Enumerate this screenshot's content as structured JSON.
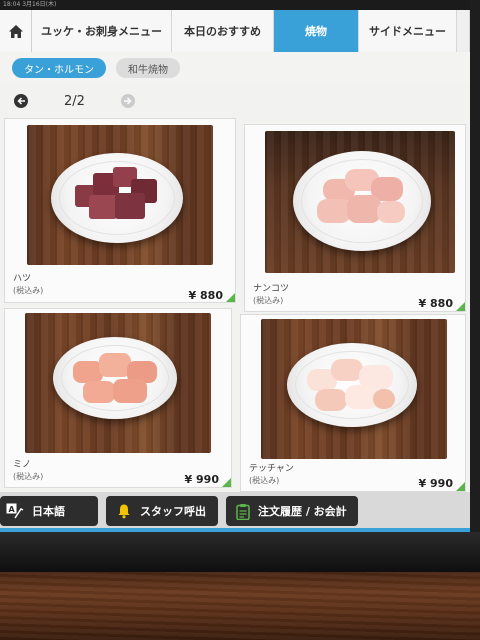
{
  "status_bar": {
    "time": "18:04  3月16日(木)"
  },
  "nav": {
    "tabs": [
      {
        "label": "ユッケ・お刺身メニュー"
      },
      {
        "label": "本日のおすすめ"
      },
      {
        "label": "焼物"
      },
      {
        "label": "サイドメニュー"
      }
    ],
    "active_tab": "焼物"
  },
  "sub_tabs": [
    {
      "label": "タン・ホルモン"
    },
    {
      "label": "和牛焼物"
    }
  ],
  "pager": {
    "indicator": "2/2"
  },
  "items": [
    {
      "name": "ハツ",
      "tax_note": "(税込み)",
      "price": "¥ 880"
    },
    {
      "name": "ナンコツ",
      "tax_note": "(税込み)",
      "price": "¥ 880"
    },
    {
      "name": "ミノ",
      "tax_note": "(税込み)",
      "price": "¥ 990"
    },
    {
      "name": "テッチャン",
      "tax_note": "(税込み)",
      "price": "¥ 990"
    }
  ],
  "toolbar": {
    "language_label": "日本語",
    "staff_call_label": "スタッフ呼出",
    "order_history_label": "注文履歴 / お会計"
  },
  "colors": {
    "accent": "#3aa0d8",
    "price_corner": "#5bb54a"
  }
}
